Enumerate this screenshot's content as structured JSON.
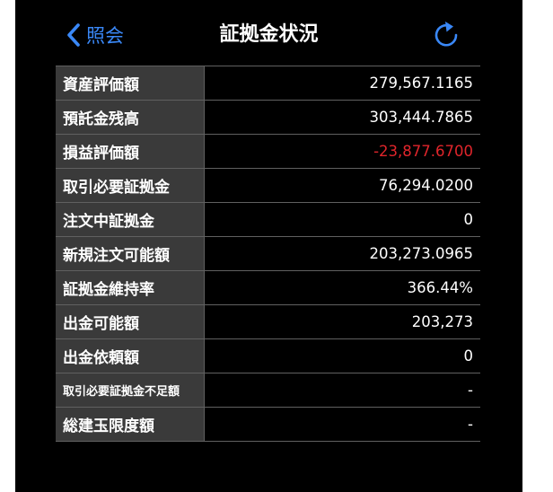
{
  "header": {
    "back_label": "照会",
    "title": "証拠金状況",
    "accent_color": "#3a88f7",
    "refresh_icon": "refresh-icon",
    "back_icon": "chevron-left-icon"
  },
  "rows": [
    {
      "label": "資産評価額",
      "value": "279,567.1165"
    },
    {
      "label": "預託金残高",
      "value": "303,444.7865"
    },
    {
      "label": "損益評価額",
      "value": "-23,877.6700",
      "negative": true
    },
    {
      "label": "取引必要証拠金",
      "value": "76,294.0200"
    },
    {
      "label": "注文中証拠金",
      "value": "0"
    },
    {
      "label": "新規注文可能額",
      "value": "203,273.0965"
    },
    {
      "label": "証拠金維持率",
      "value": "366.44%"
    },
    {
      "label": "出金可能額",
      "value": "203,273"
    },
    {
      "label": "出金依頼額",
      "value": "0"
    },
    {
      "label": "取引必要証拠金不足額",
      "value": "-",
      "small_label": true
    },
    {
      "label": "総建玉限度額",
      "value": "-"
    }
  ],
  "colors": {
    "negative": "#e0252b",
    "label_bg": "#3a3a3a",
    "background": "#000000"
  }
}
